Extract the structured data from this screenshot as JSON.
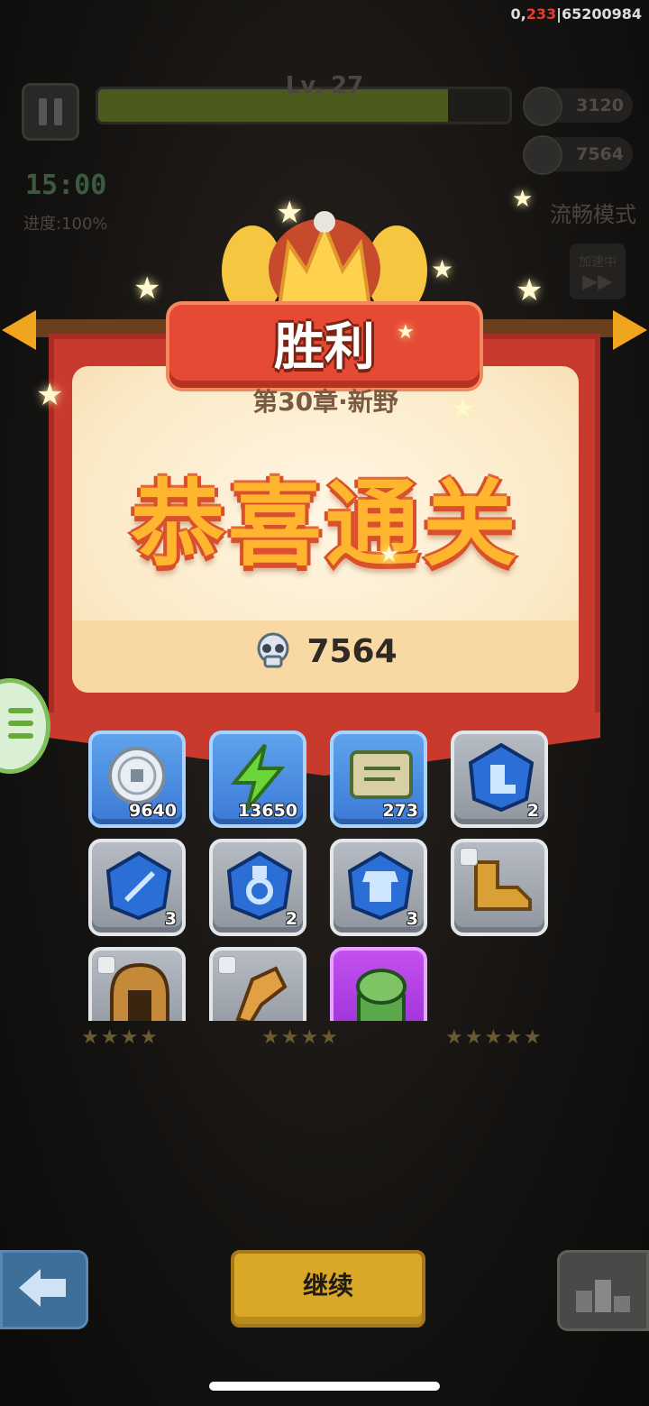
{
  "debug": {
    "prefix": "0,",
    "highlight": "233",
    "suffix": "|65200984"
  },
  "hud": {
    "level": "Lv. 27",
    "level_progress": 0.85,
    "timer": "15:00",
    "progress": "进度:100%",
    "coins": "3120",
    "kills": "7564",
    "mode": "流畅模式",
    "speed_label": "加速中"
  },
  "result": {
    "ribbon": "胜利",
    "chapter": "第30章·新野",
    "headline": "恭喜通关",
    "kill_count": "7564"
  },
  "rewards": [
    {
      "icon": "silver-coin-icon",
      "frame": "blue",
      "count": "9640"
    },
    {
      "icon": "lightning-energy-icon",
      "frame": "blue",
      "count": "13650"
    },
    {
      "icon": "scroll-icon",
      "frame": "blue",
      "count": "273"
    },
    {
      "icon": "boot-gem-icon",
      "frame": "grey",
      "count": "2"
    },
    {
      "icon": "weapon-gem-icon",
      "frame": "grey",
      "count": "3"
    },
    {
      "icon": "medal-gem-icon",
      "frame": "grey",
      "count": "2"
    },
    {
      "icon": "armor-gem-icon",
      "frame": "grey",
      "count": "3"
    },
    {
      "icon": "golden-boots-icon",
      "frame": "grey",
      "count": ""
    },
    {
      "icon": "helmet-icon",
      "frame": "grey",
      "count": ""
    },
    {
      "icon": "gauntlet-icon",
      "frame": "grey",
      "count": ""
    },
    {
      "icon": "jade-turtle-seal-icon",
      "frame": "purple",
      "count": ""
    }
  ],
  "buttons": {
    "continue": "继续"
  },
  "colors": {
    "banner_red": "#c83a2e",
    "gold": "#ffb52e",
    "blue_frame": "#3a79d6",
    "purple_frame": "#9a2fd6"
  }
}
